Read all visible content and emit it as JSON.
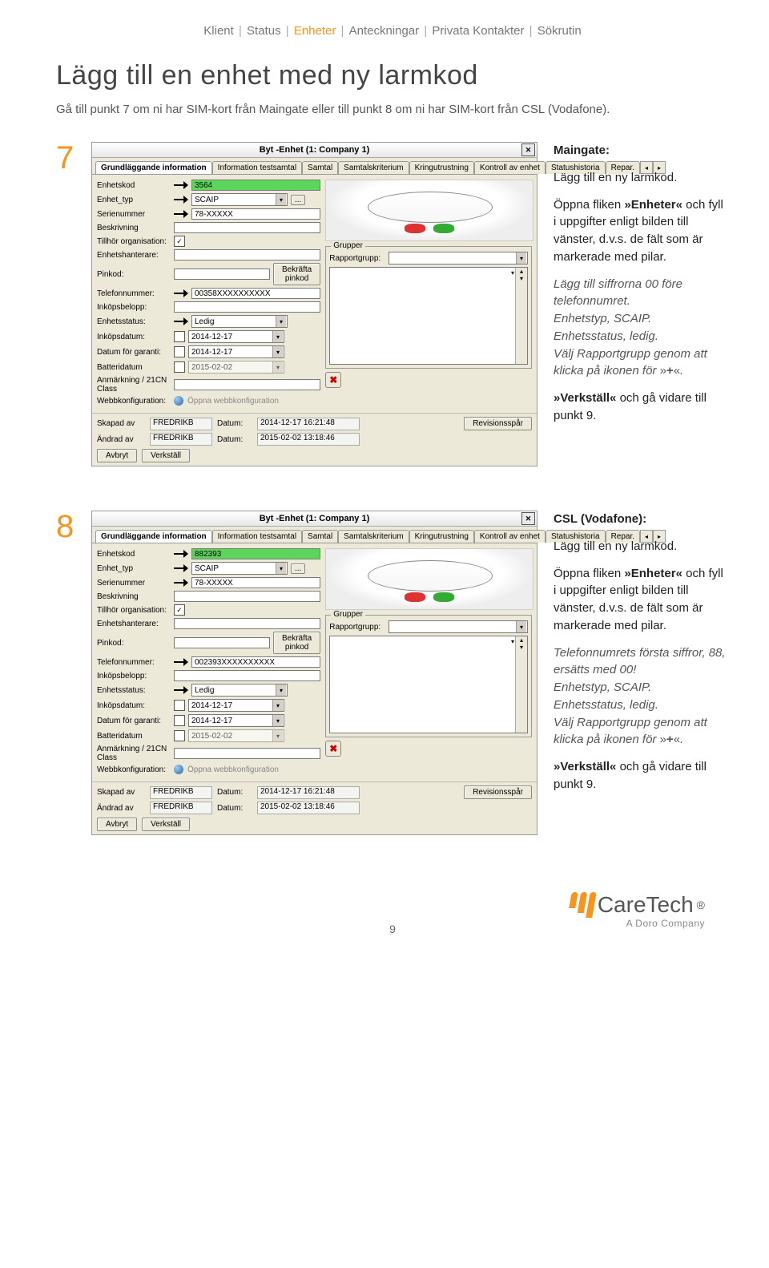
{
  "breadcrumb": [
    "Klient",
    "Status",
    "Enheter",
    "Anteckningar",
    "Privata Kontakter",
    "Sökrutin"
  ],
  "breadcrumb_active_index": 2,
  "heading": "Lägg till en enhet med ny larmkod",
  "intro": "Gå till punkt 7 om ni har SIM-kort från Maingate eller till punkt 8 om ni har SIM-kort från CSL (Vodafone).",
  "steps": [
    {
      "num": "7",
      "instructions": {
        "title": "Maingate:",
        "p1": "Lägg till en ny larmkod.",
        "p2a": "Öppna fliken",
        "p2_tab": "»Enheter«",
        "p2b": "och fyll i uppgifter enligt bilden till vänster, d.v.s. de fält som är markerade med pilar.",
        "em": "Lägg till siffrorna 00 före telefonnumret.\nEnhetstyp, SCAIP.\nEnhetsstatus, ledig.\nVälj Rapportgrupp genom att klicka på ikonen för »+«.",
        "p3a": "»Verkställ«",
        "p3b": " och gå vidare till punkt 9."
      },
      "dialog": {
        "title": "Byt -Enhet (1: Company 1)",
        "tabs": [
          "Grundläggande information",
          "Information testsamtal",
          "Samtal",
          "Samtalskriterium",
          "Kringutrustning",
          "Kontroll av enhet",
          "Statushistoria",
          "Repar."
        ],
        "fields": {
          "enhetskod": {
            "label": "Enhetskod",
            "value": "3564",
            "highlight": true,
            "arrow": true
          },
          "enhet_typ": {
            "label": "Enhet_typ",
            "value": "SCAIP",
            "arrow": true,
            "dropdown": true,
            "ext": "..."
          },
          "serienummer": {
            "label": "Serienummer",
            "value": "78-XXXXX",
            "arrow": true
          },
          "beskrivning": {
            "label": "Beskrivning",
            "value": ""
          },
          "tillhor_org": {
            "label": "Tillhör organisation:",
            "checked": true
          },
          "enhetshanterare": {
            "label": "Enhetshanterare:",
            "value": ""
          },
          "pinkod": {
            "label": "Pinkod:",
            "value": "",
            "btn": "Bekräfta pinkod"
          },
          "telefonnummer": {
            "label": "Telefonnummer:",
            "value": "00358XXXXXXXXXX",
            "arrow": true
          },
          "inkopsbelopp": {
            "label": "Inköpsbelopp:",
            "value": ""
          },
          "enhetsstatus": {
            "label": "Enhetsstatus:",
            "value": "Ledig",
            "arrow": true,
            "dropdown": true
          },
          "inkopsdatum": {
            "label": "Inköpsdatum:",
            "value": "2014-12-17",
            "dropdown": true
          },
          "datum_garanti": {
            "label": "Datum för garanti:",
            "value": "2014-12-17",
            "dropdown": true
          },
          "batteridatum": {
            "label": "Batteridatum",
            "value": "2015-02-02",
            "dropdown": true,
            "dim": true
          },
          "anmarkning": {
            "label": "Anmärkning / 21CN Class",
            "value": ""
          },
          "webbkonfig": {
            "label": "Webbkonfiguration:",
            "link": "Öppna webbkonfiguration"
          }
        },
        "group_title": "Grupper",
        "group_field": "Rapportgrupp:",
        "footer": {
          "skapad_av_lbl": "Skapad av",
          "skapad_av": "FREDRIKB",
          "andrad_av_lbl": "Ändrad av",
          "andrad_av": "FREDRIKB",
          "datum1_lbl": "Datum:",
          "datum1": "2014-12-17 16:21:48",
          "datum2_lbl": "Datum:",
          "datum2": "2015-02-02 13:18:46",
          "rev": "Revisionsspår",
          "avbryt": "Avbryt",
          "verkstall": "Verkställ"
        }
      }
    },
    {
      "num": "8",
      "instructions": {
        "title": "CSL (Vodafone):",
        "p1": "Lägg till en ny larmkod.",
        "p2a": "Öppna fliken",
        "p2_tab": "»Enheter«",
        "p2b": "och fyll i uppgifter enligt bilden till vänster, d.v.s. de fält som är markerade med pilar.",
        "em": "Telefonnumrets första siffror, 88, ersätts med 00!\nEnhetstyp, SCAIP.\nEnhetsstatus, ledig.\nVälj Rapportgrupp genom att klicka på ikonen för »+«.",
        "p3a": "»Verkställ«",
        "p3b": " och gå vidare till punkt 9."
      },
      "dialog": {
        "title": "Byt -Enhet (1: Company 1)",
        "tabs": [
          "Grundläggande information",
          "Information testsamtal",
          "Samtal",
          "Samtalskriterium",
          "Kringutrustning",
          "Kontroll av enhet",
          "Statushistoria",
          "Repar."
        ],
        "fields": {
          "enhetskod": {
            "label": "Enhetskod",
            "value": "882393",
            "highlight": true,
            "arrow": true
          },
          "enhet_typ": {
            "label": "Enhet_typ",
            "value": "SCAIP",
            "arrow": true,
            "dropdown": true,
            "ext": "..."
          },
          "serienummer": {
            "label": "Serienummer",
            "value": "78-XXXXX",
            "arrow": true
          },
          "beskrivning": {
            "label": "Beskrivning",
            "value": ""
          },
          "tillhor_org": {
            "label": "Tillhör organisation:",
            "checked": true
          },
          "enhetshanterare": {
            "label": "Enhetshanterare:",
            "value": ""
          },
          "pinkod": {
            "label": "Pinkod:",
            "value": "",
            "btn": "Bekräfta pinkod"
          },
          "telefonnummer": {
            "label": "Telefonnummer:",
            "value": "002393XXXXXXXXXX",
            "arrow": true
          },
          "inkopsbelopp": {
            "label": "Inköpsbelopp:",
            "value": ""
          },
          "enhetsstatus": {
            "label": "Enhetsstatus:",
            "value": "Ledig",
            "arrow": true,
            "dropdown": true
          },
          "inkopsdatum": {
            "label": "Inköpsdatum:",
            "value": "2014-12-17",
            "dropdown": true
          },
          "datum_garanti": {
            "label": "Datum för garanti:",
            "value": "2014-12-17",
            "dropdown": true
          },
          "batteridatum": {
            "label": "Batteridatum",
            "value": "2015-02-02",
            "dropdown": true,
            "dim": true
          },
          "anmarkning": {
            "label": "Anmärkning / 21CN Class",
            "value": ""
          },
          "webbkonfig": {
            "label": "Webbkonfiguration:",
            "link": "Öppna webbkonfiguration"
          }
        },
        "group_title": "Grupper",
        "group_field": "Rapportgrupp:",
        "footer": {
          "skapad_av_lbl": "Skapad av",
          "skapad_av": "FREDRIKB",
          "andrad_av_lbl": "Ändrad av",
          "andrad_av": "FREDRIKB",
          "datum1_lbl": "Datum:",
          "datum1": "2014-12-17 16:21:48",
          "datum2_lbl": "Datum:",
          "datum2": "2015-02-02 13:18:46",
          "rev": "Revisionsspår",
          "avbryt": "Avbryt",
          "verkstall": "Verkställ"
        }
      }
    }
  ],
  "brand": {
    "name": "CareTech",
    "sub": "A Doro Company"
  },
  "page_number": "9"
}
